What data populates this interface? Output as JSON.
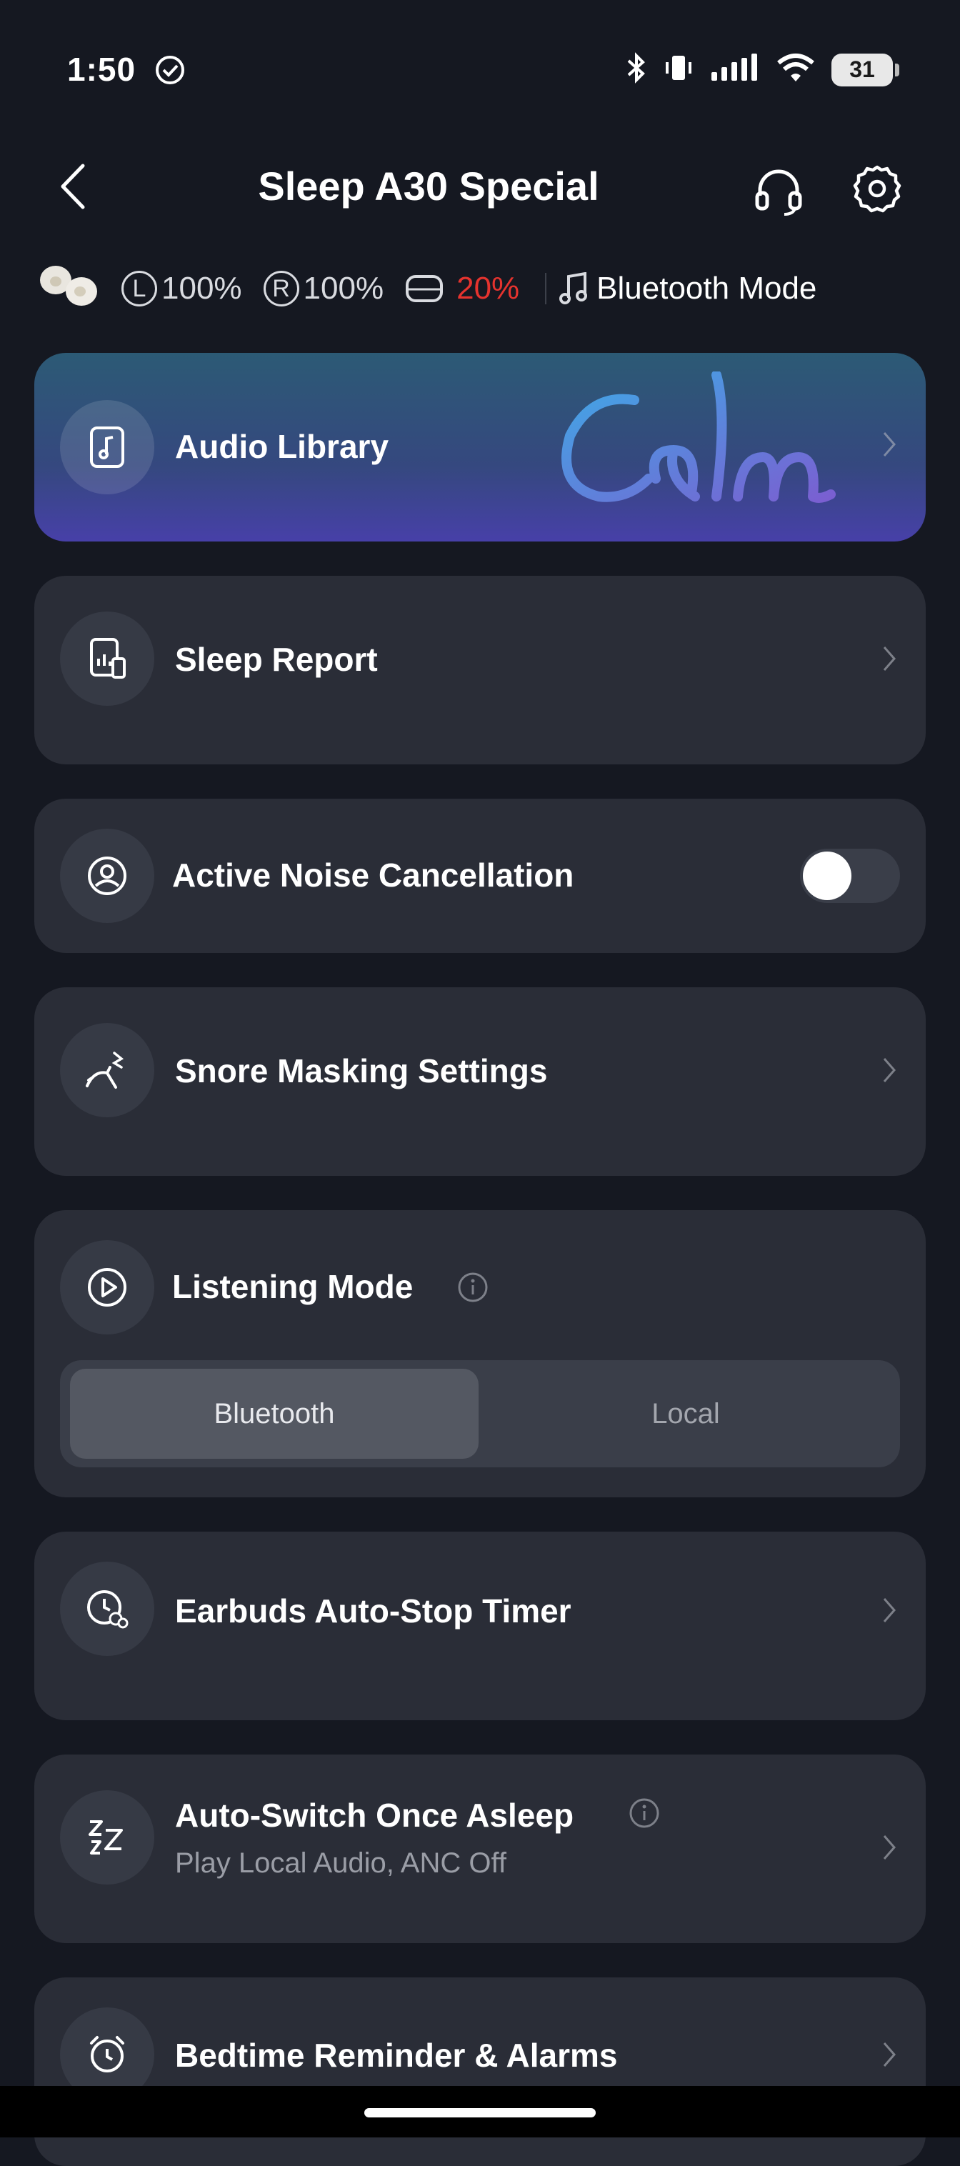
{
  "status_bar": {
    "time": "1:50",
    "battery": "31"
  },
  "header": {
    "title": "Sleep A30 Special"
  },
  "device_status": {
    "left_label": "L",
    "left_pct": "100%",
    "right_label": "R",
    "right_pct": "100%",
    "case_pct": "20%",
    "mode": "Bluetooth Mode"
  },
  "cards": {
    "audio_library": {
      "title": "Audio Library",
      "brand": "Calm"
    },
    "sleep_report": {
      "title": "Sleep Report"
    },
    "anc": {
      "title": "Active Noise Cancellation",
      "enabled": false
    },
    "snore": {
      "title": "Snore Masking Settings"
    },
    "listening_mode": {
      "title": "Listening Mode",
      "options": [
        "Bluetooth",
        "Local"
      ],
      "selected": "Bluetooth"
    },
    "auto_stop": {
      "title": "Earbuds Auto-Stop Timer"
    },
    "auto_switch": {
      "title": "Auto-Switch Once Asleep",
      "subtitle": "Play Local Audio, ANC Off"
    },
    "bedtime": {
      "title": "Bedtime Reminder & Alarms"
    }
  },
  "colors": {
    "background": "#151821",
    "card": "#2a2d37",
    "warning": "#e5332e",
    "calm_gradient": [
      "#3fa9e6",
      "#7a5fd1"
    ]
  }
}
